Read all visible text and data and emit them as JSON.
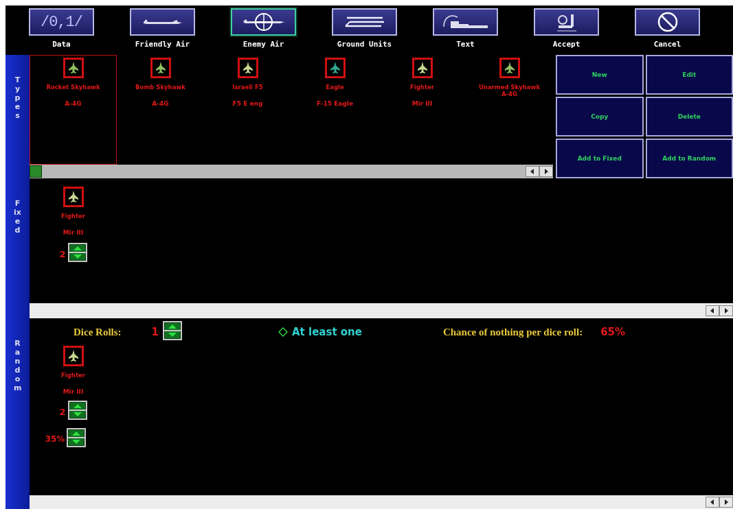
{
  "toolbar": [
    {
      "label": "Data",
      "kind": "tab",
      "selected": false,
      "icon_text": "/0,1/"
    },
    {
      "label": "Friendly Air",
      "kind": "tab",
      "selected": false
    },
    {
      "label": "Enemy Air",
      "kind": "tab",
      "selected": true
    },
    {
      "label": "Ground Units",
      "kind": "tab",
      "selected": false
    },
    {
      "label": "Text",
      "kind": "tab",
      "selected": false
    },
    {
      "label": "Accept",
      "kind": "action"
    },
    {
      "label": "Cancel",
      "kind": "action"
    }
  ],
  "types": {
    "title": "Types",
    "items": [
      {
        "name": "Rocket Skyhawk",
        "designation": "A-4G",
        "selected": true,
        "color": "#8fc060"
      },
      {
        "name": "Bomb Skyhawk",
        "designation": "A-4G",
        "selected": false,
        "color": "#8fc060"
      },
      {
        "name": "Israeli F5",
        "designation": "F5 E eng",
        "selected": false,
        "color": "#c8d890"
      },
      {
        "name": "Eagle",
        "designation": "F-15 Eagle",
        "selected": false,
        "color": "#30a890"
      },
      {
        "name": "Fighter",
        "designation": "Mir III",
        "selected": false,
        "color": "#c8d890"
      },
      {
        "name": "Unarmed Skyhawk A-4G",
        "selected": false,
        "color": "#8fc060"
      }
    ],
    "buttons": [
      "New",
      "Edit",
      "Copy",
      "Delete",
      "Add to Fixed",
      "Add to Random"
    ]
  },
  "fixed": {
    "title": "Fixed",
    "items": [
      {
        "name": "Fighter",
        "designation": "Mir III",
        "count": "2",
        "color": "#c8d890"
      }
    ]
  },
  "random": {
    "title": "Random",
    "dice_rolls_label": "Dice Rolls:",
    "dice_rolls": "1",
    "at_least_one": {
      "label": "At least one",
      "checked": false
    },
    "chance_label": "Chance of nothing per dice roll:",
    "chance": "65%",
    "items": [
      {
        "name": "Fighter",
        "designation": "Mir III",
        "count": "2",
        "probability": "35%",
        "color": "#c8d890"
      }
    ]
  }
}
